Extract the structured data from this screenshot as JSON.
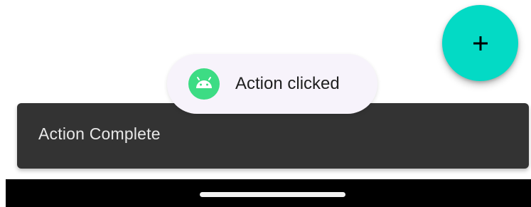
{
  "fab": {
    "icon": "plus-icon",
    "color": "#03dac5",
    "icon_color": "#000000"
  },
  "snackbar": {
    "message": "Action Complete",
    "background": "#333333"
  },
  "toast": {
    "message": "Action clicked",
    "icon": "android-app-icon",
    "icon_color": "#3ddc84"
  },
  "nav": {
    "handle_icon": "home-gesture-handle"
  }
}
